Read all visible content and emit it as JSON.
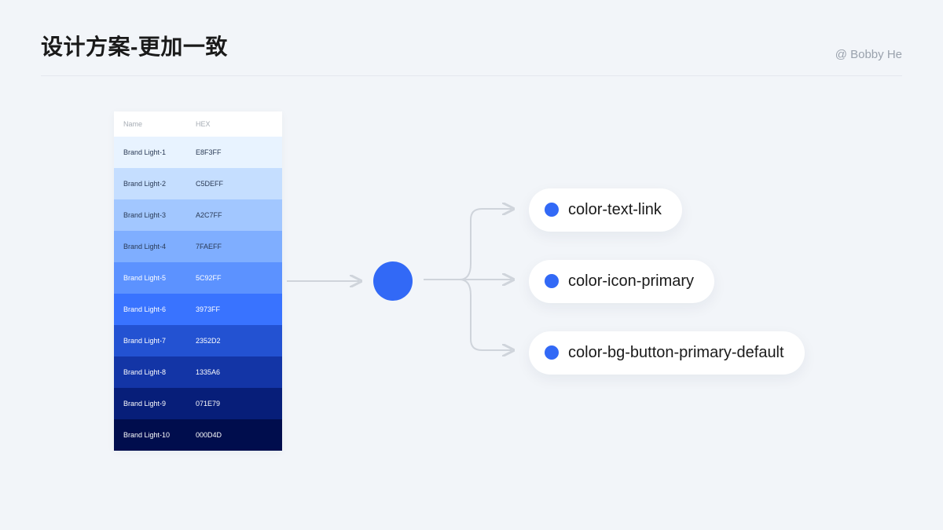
{
  "header": {
    "title": "设计方案-更加一致",
    "author": "@ Bobby He"
  },
  "palette": {
    "header_name": "Name",
    "header_hex": "HEX",
    "rows": [
      {
        "name": "Brand Light-1",
        "hex": "E8F3FF",
        "bg": "#E8F3FF",
        "tone": "dark"
      },
      {
        "name": "Brand Light-2",
        "hex": "C5DEFF",
        "bg": "#C5DEFF",
        "tone": "dark"
      },
      {
        "name": "Brand Light-3",
        "hex": "A2C7FF",
        "bg": "#A2C7FF",
        "tone": "dark"
      },
      {
        "name": "Brand Light-4",
        "hex": "7FAEFF",
        "bg": "#7FAEFF",
        "tone": "dark"
      },
      {
        "name": "Brand Light-5",
        "hex": "5C92FF",
        "bg": "#5C92FF",
        "tone": "light"
      },
      {
        "name": "Brand Light-6",
        "hex": "3973FF",
        "bg": "#3973FF",
        "tone": "light"
      },
      {
        "name": "Brand Light-7",
        "hex": "2352D2",
        "bg": "#2352D2",
        "tone": "light"
      },
      {
        "name": "Brand Light-8",
        "hex": "1335A6",
        "bg": "#1335A6",
        "tone": "light"
      },
      {
        "name": "Brand Light-9",
        "hex": "071E79",
        "bg": "#071E79",
        "tone": "light"
      },
      {
        "name": "Brand Light-10",
        "hex": "000D4D",
        "bg": "#000D4D",
        "tone": "light"
      }
    ]
  },
  "primary_color": "#3269f6",
  "tokens": [
    {
      "label": "color-text-link"
    },
    {
      "label": "color-icon-primary"
    },
    {
      "label": "color-bg-button-primary-default"
    }
  ]
}
